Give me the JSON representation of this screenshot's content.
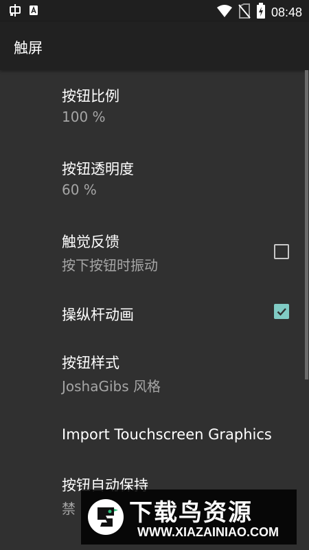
{
  "status_bar": {
    "time": "08:48",
    "icons": [
      "bug-icon",
      "a-box-icon",
      "wifi-icon",
      "no-sim-icon",
      "battery-charging-icon"
    ]
  },
  "toolbar": {
    "title": "触屏"
  },
  "preferences": [
    {
      "title": "按钮比例",
      "summary": "100 %"
    },
    {
      "title": "按钮透明度",
      "summary": "60 %"
    },
    {
      "title": "触觉反馈",
      "summary": "按下按钮时振动",
      "checked": false
    },
    {
      "title": "操纵杆动画",
      "checked": true
    },
    {
      "title": "按钮样式",
      "summary": "JoshaGibs 风格"
    },
    {
      "title": "Import Touchscreen Graphics"
    },
    {
      "title": "按钮自动保持",
      "summary": "禁"
    }
  ],
  "watermark": {
    "title": "下载鸟资源",
    "url": "WWW.XIAZAINIAO.COM"
  },
  "colors": {
    "background": "#303030",
    "toolbar": "#212121",
    "status_bar": "#1f1f1f",
    "accent": "#80cbc4",
    "summary_text": "#a6a6a6"
  }
}
